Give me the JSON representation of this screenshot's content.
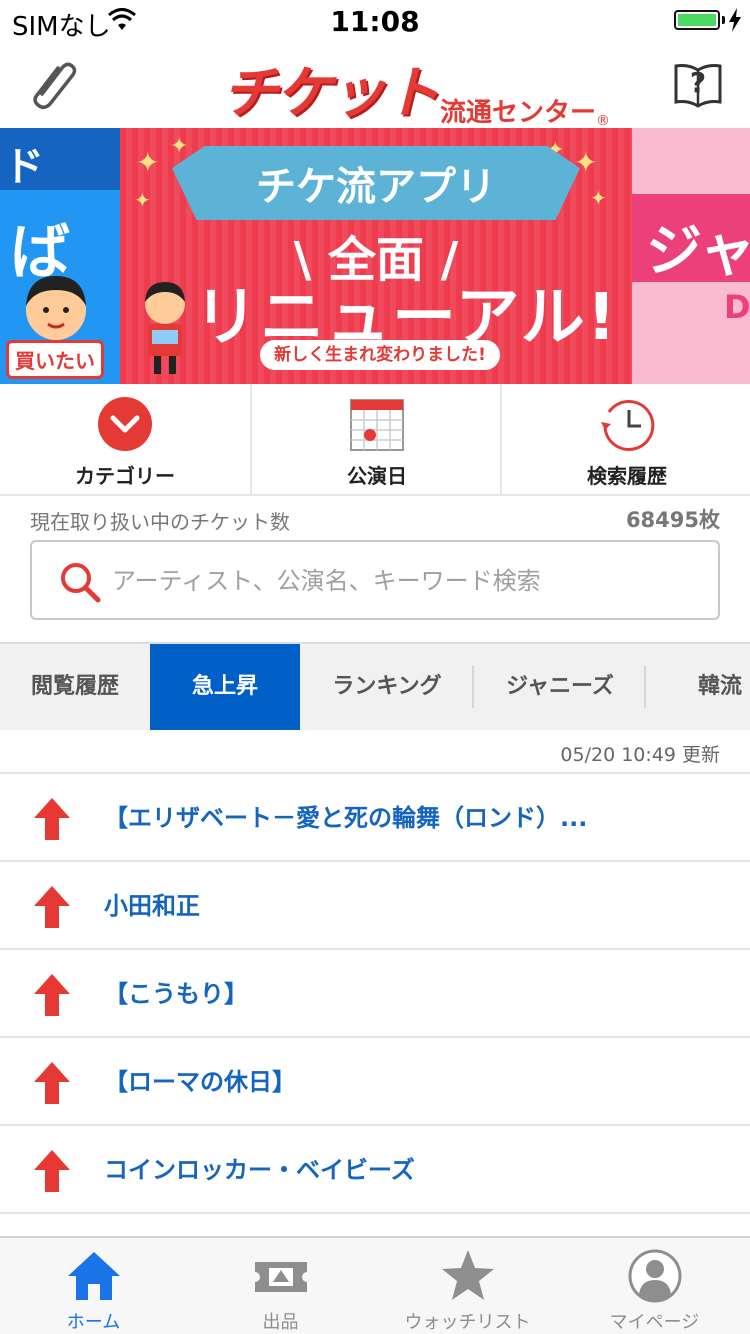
{
  "status_bar": {
    "carrier": "SIMなし",
    "time": "11:08"
  },
  "header": {
    "logo_main": "チケット",
    "logo_sub": "流通センター",
    "logo_reg": "®"
  },
  "banner": {
    "left_tab": "ド",
    "left_text": "ば",
    "left_button": "買いたい",
    "ribbon": "チケ流アプリ",
    "line1": "\\ 全面 /",
    "line2": "リニューアル!",
    "bubble": "新しく生まれ変わりました!",
    "right_text": "ジャ",
    "right_sub": "D"
  },
  "quick_menu": [
    {
      "label": "カテゴリー"
    },
    {
      "label": "公演日"
    },
    {
      "label": "検索履歴"
    }
  ],
  "ticket_count": {
    "label": "現在取り扱い中のチケット数",
    "value": "68495枚"
  },
  "search": {
    "placeholder": "アーティスト、公演名、キーワード検索",
    "value": ""
  },
  "tabs": [
    {
      "label": "閲覧履歴",
      "active": false
    },
    {
      "label": "急上昇",
      "active": true
    },
    {
      "label": "ランキング",
      "active": false
    },
    {
      "label": "ジャニーズ",
      "active": false
    },
    {
      "label": "韓流",
      "active": false
    }
  ],
  "updated": "05/20 10:49 更新",
  "list": [
    {
      "title": "【エリザベート－愛と死の輪舞（ロンド）..."
    },
    {
      "title": "小田和正"
    },
    {
      "title": "【こうもり】"
    },
    {
      "title": "【ローマの休日】"
    },
    {
      "title": "コインロッカー・ベイビーズ"
    }
  ],
  "bottom_nav": [
    {
      "label": "ホーム",
      "icon": "home-icon",
      "active": true
    },
    {
      "label": "出品",
      "icon": "ticket-upload-icon",
      "active": false
    },
    {
      "label": "ウォッチリスト",
      "icon": "star-icon",
      "active": false
    },
    {
      "label": "マイページ",
      "icon": "user-icon",
      "active": false
    }
  ],
  "colors": {
    "brand_red": "#e53935",
    "active_tab": "#0060c7",
    "link_blue": "#1565c0",
    "nav_active": "#1a73e8"
  }
}
